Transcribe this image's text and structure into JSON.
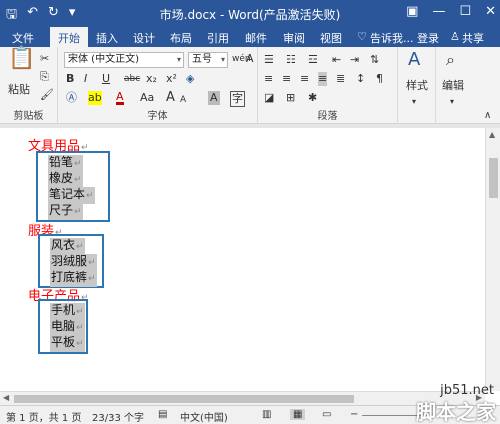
{
  "titlebar": {
    "title": "市场.docx - Word(产品激活失败)",
    "save_icon": "save-icon",
    "undo_icon": "undo-icon",
    "redo_icon": "redo-icon"
  },
  "tabs": {
    "file": "文件",
    "home": "开始",
    "insert": "插入",
    "design": "设计",
    "layout": "布局",
    "references": "引用",
    "mailings": "邮件",
    "review": "审阅",
    "view": "视图",
    "tell_me": "告诉我...",
    "login": "登录",
    "share": "共享"
  },
  "ribbon": {
    "clipboard": {
      "paste": "粘贴",
      "label": "剪贴板"
    },
    "font": {
      "font_name": "宋体 (中文正文)",
      "font_size": "五号",
      "label": "字体",
      "bold": "B",
      "italic": "I",
      "underline": "U",
      "strike": "abc",
      "subscript": "x₂",
      "superscript": "x²",
      "case": "Aa",
      "grow": "A",
      "shrink": "A"
    },
    "paragraph": {
      "label": "段落"
    },
    "styles": {
      "label": "样式"
    },
    "editing": {
      "label": "编辑"
    }
  },
  "document": {
    "sections": [
      {
        "heading": "文具用品",
        "items": [
          "铅笔",
          "橡皮",
          "笔记本",
          "尺子"
        ]
      },
      {
        "heading": "服装",
        "items": [
          "风衣",
          "羽绒服",
          "打底裤"
        ]
      },
      {
        "heading": "电子产品",
        "items": [
          "手机",
          "电脑",
          "平板"
        ]
      }
    ],
    "para_mark": "↵"
  },
  "statusbar": {
    "page": "第 1 页，共 1 页",
    "words": "23/33 个字",
    "language": "中文(中国)"
  },
  "watermark": {
    "site": "jb51.net",
    "brand": "脚本之家"
  },
  "accent_color": "#2b579a",
  "box_color": "#2e75b6",
  "heading_color": "#ff0000"
}
